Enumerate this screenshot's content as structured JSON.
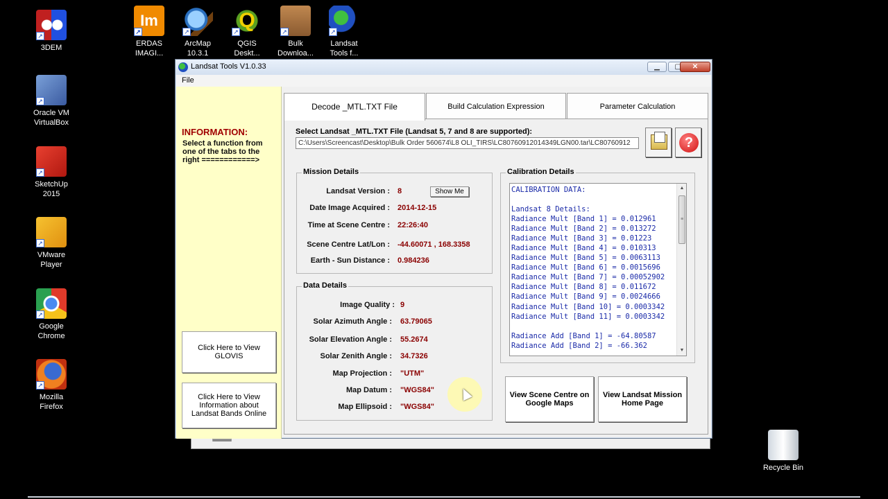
{
  "desktop": {
    "left_icons": [
      {
        "label": "3DEM",
        "icon": "3dem-icon"
      },
      {
        "label": "Oracle VM\nVirtualBox",
        "icon": "virtualbox-icon"
      },
      {
        "label": "SketchUp\n2015",
        "icon": "sketchup-icon"
      },
      {
        "label": "VMware\nPlayer",
        "icon": "vmware-icon"
      },
      {
        "label": "Google\nChrome",
        "icon": "chrome-icon"
      },
      {
        "label": "Mozilla\nFirefox",
        "icon": "firefox-icon"
      }
    ],
    "top_icons": [
      {
        "label": "ERDAS\nIMAGI...",
        "icon": "erdas-icon",
        "glyph": "Im"
      },
      {
        "label": "ArcMap\n10.3.1",
        "icon": "arcmap-icon"
      },
      {
        "label": "QGIS\nDeskt...",
        "icon": "qgis-icon",
        "glyph": "Q"
      },
      {
        "label": "Bulk\nDownloa...",
        "icon": "bulk-download-icon"
      },
      {
        "label": "Landsat\nTools f...",
        "icon": "landsat-tools-icon"
      }
    ],
    "recycle_bin": {
      "label": "Recycle Bin",
      "icon": "recycle-bin-icon"
    }
  },
  "window": {
    "title": "Landsat Tools V1.0.33",
    "controls": {
      "minimize": "▁",
      "maximize": "▢",
      "close": "✕"
    },
    "menu": [
      "File"
    ]
  },
  "left_panel": {
    "info_heading": "INFORMATION:",
    "info_text": "Select a function from one of the tabs to the right ============>",
    "glovis_button": "Click Here to View GLOVIS",
    "bands_button": "Click Here to View Information about Landsat Bands Online"
  },
  "tabs": [
    "Decode _MTL.TXT File",
    "Build Calculation Expression",
    "Parameter Calculation"
  ],
  "decode": {
    "select_label": "Select Landsat _MTL.TXT File (Landsat 5, 7 and 8 are supported):",
    "file_path": "C:\\Users\\Screencast\\Desktop\\Bulk Order 560674\\L8 OLI_TIRS\\LC80760912014349LGN00.tar\\LC80760912",
    "help_glyph": "?",
    "mission": {
      "title": "Mission Details",
      "show_me": "Show Me",
      "rows": [
        {
          "key": "Landsat Version :",
          "value": "8"
        },
        {
          "key": "Date Image Acquired :",
          "value": "2014-12-15"
        },
        {
          "key": "Time at Scene Centre :",
          "value": "22:26:40"
        },
        {
          "key": "Scene Centre Lat/Lon :",
          "value": "-44.60071 , 168.3358"
        },
        {
          "key": "Earth - Sun Distance :",
          "value": "0.984236"
        }
      ]
    },
    "data_details": {
      "title": "Data Details",
      "rows": [
        {
          "key": "Image Quality :",
          "value": "9"
        },
        {
          "key": "Solar Azimuth Angle :",
          "value": "63.79065"
        },
        {
          "key": "Solar Elevation Angle :",
          "value": "55.2674"
        },
        {
          "key": "Solar Zenith Angle :",
          "value": "34.7326"
        },
        {
          "key": "Map Projection :",
          "value": "\"UTM\""
        },
        {
          "key": "Map Datum :",
          "value": "\"WGS84\""
        },
        {
          "key": "Map Ellipsoid :",
          "value": "\"WGS84\""
        }
      ]
    },
    "calibration": {
      "title": "Calibration Details",
      "lines": [
        "CALIBRATION DATA:",
        "",
        "Landsat 8 Details:",
        "Radiance Mult [Band 1] = 0.012961",
        "Radiance Mult [Band 2] = 0.013272",
        "Radiance Mult [Band 3] = 0.01223",
        "Radiance Mult [Band 4] = 0.010313",
        "Radiance Mult [Band 5] = 0.0063113",
        "Radiance Mult [Band 6] = 0.0015696",
        "Radiance Mult [Band 7] = 0.00052902",
        "Radiance Mult [Band 8] = 0.011672",
        "Radiance Mult [Band 9] = 0.0024666",
        "Radiance Mult [Band 10] = 0.0003342",
        "Radiance Mult [Band 11] = 0.0003342",
        "",
        "Radiance Add [Band 1] = -64.80587",
        "Radiance Add [Band 2] = -66.362"
      ],
      "scroll_up": "▲",
      "scroll_down": "▼",
      "thumb_grip": "≡"
    },
    "google_maps_button": "View Scene Centre on Google Maps",
    "mission_home_button": "View Landsat Mission Home Page"
  },
  "colors": {
    "info_heading": "#a00000",
    "value_text": "#8a0000",
    "calibration_text": "#1a2aa8",
    "left_panel_bg": "#ffffc8"
  }
}
